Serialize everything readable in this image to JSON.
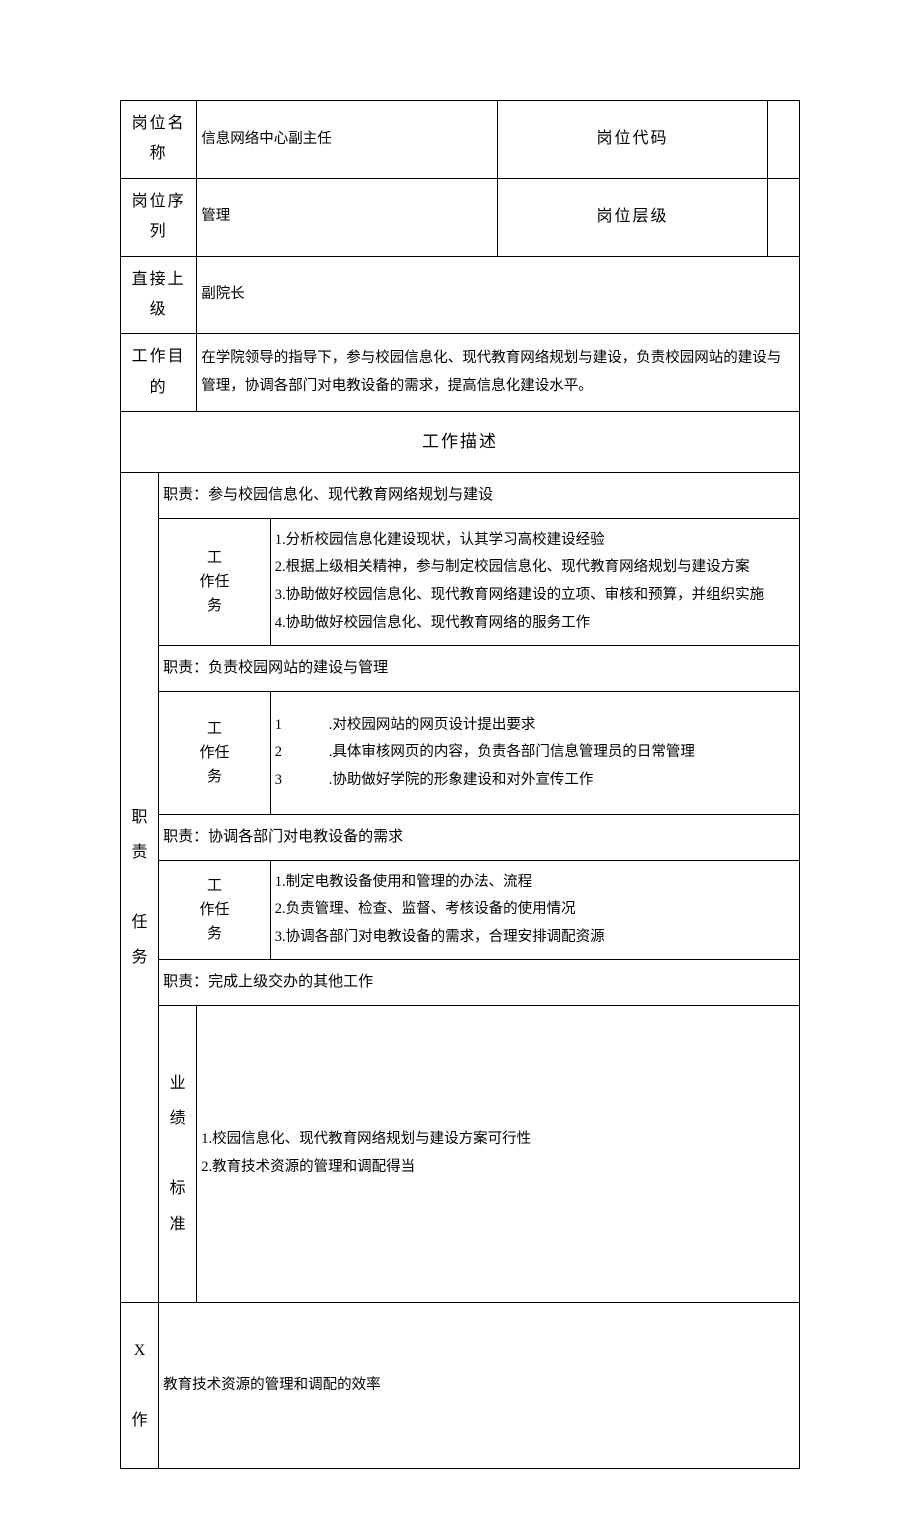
{
  "header": {
    "position_name_label": "岗位名称",
    "position_name_value": "信息网络中心副主任",
    "position_code_label": "岗位代码",
    "position_code_value": "",
    "position_series_label": "岗位序列",
    "position_series_value": "管理",
    "position_level_label": "岗位层级",
    "position_level_value": "",
    "supervisor_label": "直接上级",
    "supervisor_value": "副院长",
    "purpose_label": "工作目的",
    "purpose_value": "在学院领导的指导下，参与校园信息化、现代教育网络规划与建设，负责校园网站的建设与管理，协调各部门对电教设备的需求，提高信息化建设水平。"
  },
  "job_description_label": "工作描述",
  "duties_tasks_label": "职责\n\n任务",
  "task_group_label": "工\n作任\n务",
  "duty_prefix": "职责：",
  "duties": [
    {
      "title": "参与校园信息化、现代教育网络规划与建设",
      "tasks": [
        "1.分析校园信息化建设现状，认其学习高校建设经验",
        "2.根据上级相关精神，参与制定校园信息化、现代教育网络规划与建设方案",
        "3.协助做好校园信息化、现代教育网络建设的立项、审核和预算，并组织实施",
        "4.协助做好校园信息化、现代教育网络的服务工作"
      ]
    },
    {
      "title": "负责校园网站的建设与管理",
      "tasks_numbered": [
        {
          "idx": "1",
          "txt": ".对校园网站的网页设计提出要求"
        },
        {
          "idx": "2",
          "txt": ".具体审核网页的内容，负责各部门信息管理员的日常管理"
        },
        {
          "idx": "3",
          "txt": ".协助做好学院的形象建设和对外宣传工作"
        }
      ]
    },
    {
      "title": "协调各部门对电教设备的需求",
      "tasks": [
        "1.制定电教设备使用和管理的办法、流程",
        "2.负责管理、检查、监督、考核设备的使用情况",
        "3.协调各部门对电教设备的需求，合理安排调配资源"
      ]
    },
    {
      "title": "完成上级交办的其他工作"
    }
  ],
  "performance_label": "业绩\n\n标准",
  "performance_items": [
    "1.校园信息化、现代教育网络规划与建设方案可行性",
    "2.教育技术资源的管理和调配得当"
  ],
  "x_section_label": "X\n\n作",
  "x_section_value": "教育技术资源的管理和调配的效率"
}
